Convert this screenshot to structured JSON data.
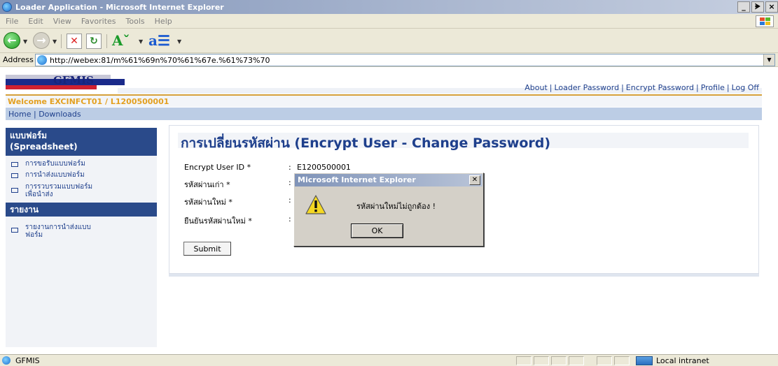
{
  "window": {
    "title": "Loader Application - Microsoft Internet Explorer",
    "controls": [
      "_",
      "ᗙ",
      "×"
    ]
  },
  "menu": [
    "File",
    "Edit",
    "View",
    "Favorites",
    "Tools",
    "Help"
  ],
  "address": {
    "label": "Address",
    "url": "http://webex:81/m%61%69n%70%61%67e.%61%73%70"
  },
  "header": {
    "logo_text": "GFMIS",
    "links": [
      "About",
      "Loader Password",
      "Encrypt Password",
      "Profile",
      "Log Off"
    ],
    "welcome": "Welcome  EXCINFCT01 / L1200500001",
    "nav": [
      "Home",
      "Downloads"
    ]
  },
  "sidebar": {
    "section1_title_line1": "แบบฟอร์ม",
    "section1_title_line2": "(Spreadsheet)",
    "section1_items": [
      "การขอรับแบบฟอร์ม",
      "การนำส่งแบบฟอร์ม",
      "การรวบรวมแบบฟอร์ม\nเพื่อนำส่ง"
    ],
    "section2_title": "รายงาน",
    "section2_items": [
      "รายงานการนำส่งแบบ\nฟอร์ม"
    ]
  },
  "form": {
    "title": "การเปลี่ยนรหัสผ่าน (Encrypt User - Change Password)",
    "fields": [
      {
        "label": "Encrypt User ID  *",
        "value": "E1200500001"
      },
      {
        "label": "รหัสผ่านเก่า  *",
        "value": ""
      },
      {
        "label": "รหัสผ่านใหม่  *",
        "value": ""
      },
      {
        "label": "ยืนยันรหัสผ่านใหม่  *",
        "value": ""
      }
    ],
    "submit_label": "Submit"
  },
  "dialog": {
    "title": "Microsoft Internet Explorer",
    "message": "รหัสผ่านใหม่ไม่ถูกต้อง !",
    "ok_label": "OK"
  },
  "status": {
    "text": "GFMIS",
    "zone": "Local intranet"
  }
}
